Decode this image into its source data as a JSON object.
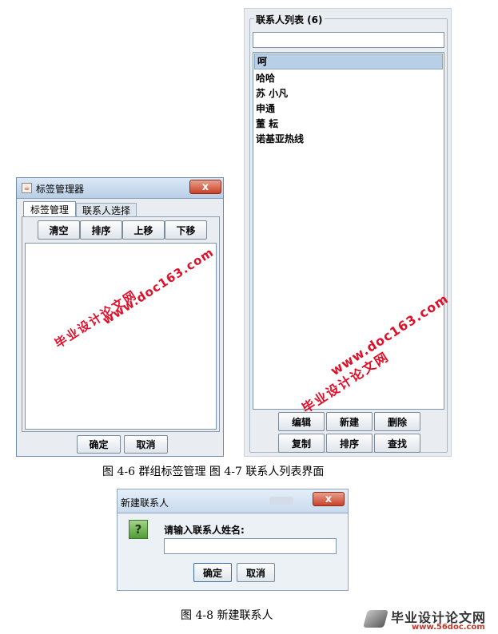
{
  "tag_manager": {
    "title": "标签管理器",
    "close_glyph": "x",
    "tabs": [
      "标签管理",
      "联系人选择"
    ],
    "toolbar": [
      "清空",
      "排序",
      "上移",
      "下移"
    ],
    "ok_label": "确定",
    "cancel_label": "取消"
  },
  "contact_list": {
    "group_title": "联系人列表 (6)",
    "search_value": "",
    "items": [
      "呵",
      "哈哈",
      "苏 小凡",
      "申通",
      "董 耘",
      "诺基亚热线"
    ],
    "selected_index": 0,
    "buttons_row1": [
      "编辑",
      "新建",
      "删除"
    ],
    "buttons_row2": [
      "复制",
      "排序",
      "查找"
    ]
  },
  "new_contact_dialog": {
    "title": "新建联系人",
    "close_glyph": "x",
    "icon_glyph": "?",
    "prompt": "请输入联系人姓名:",
    "input_value": "",
    "ok_label": "确定",
    "cancel_label": "取消"
  },
  "captions": {
    "fig_4_6_4_7": "图 4-6 群组标签管理   图 4-7 联系人列表界面",
    "fig_4_8": "图 4-8 新建联系人"
  },
  "watermarks": {
    "site_cn": "毕业设计论文网",
    "site_url": "www.doc163.com",
    "footer_cn": "毕业设计论文网",
    "footer_url": "www.56doc.com"
  },
  "colors": {
    "selected_row": "#b8cfe5",
    "watermark_red": "#e0102a",
    "titlebar": "#c5d8ec"
  }
}
